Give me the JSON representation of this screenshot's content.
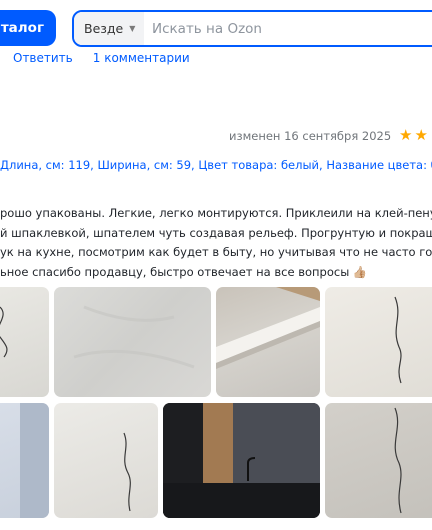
{
  "header": {
    "catalog_label": "Каталог",
    "search_scope": "Везде",
    "search_placeholder": "Искать на Ozon"
  },
  "actions": {
    "reply": "Ответить",
    "comments": "1 комментарии"
  },
  "review": {
    "edited": "изменен 16 сентября 2025",
    "rating_stars": 2,
    "params": "Длина, см: 119, Ширина, см: 59, Цвет товара: белый, Название цвета: белый",
    "text_lines": [
      "рошо упакованы. Легкие, легко монтируются. Приклеили на клей-пену. Ш",
      "й шпаклевкой, шпателем чуть создавая рельеф. Прогрунтую и покрашу м",
      "ук на кухне, посмотрим как будет в быту, но учитывая что не часто готовл",
      "ьное спасибо продавцу, быстро отвечает на все вопросы 👍🏼"
    ]
  },
  "colors": {
    "accent": "#005bff",
    "star": "#ffa800",
    "muted": "#70757a"
  },
  "icons": {
    "scope_dropdown": "chevron-down-icon",
    "star": "star-icon"
  }
}
